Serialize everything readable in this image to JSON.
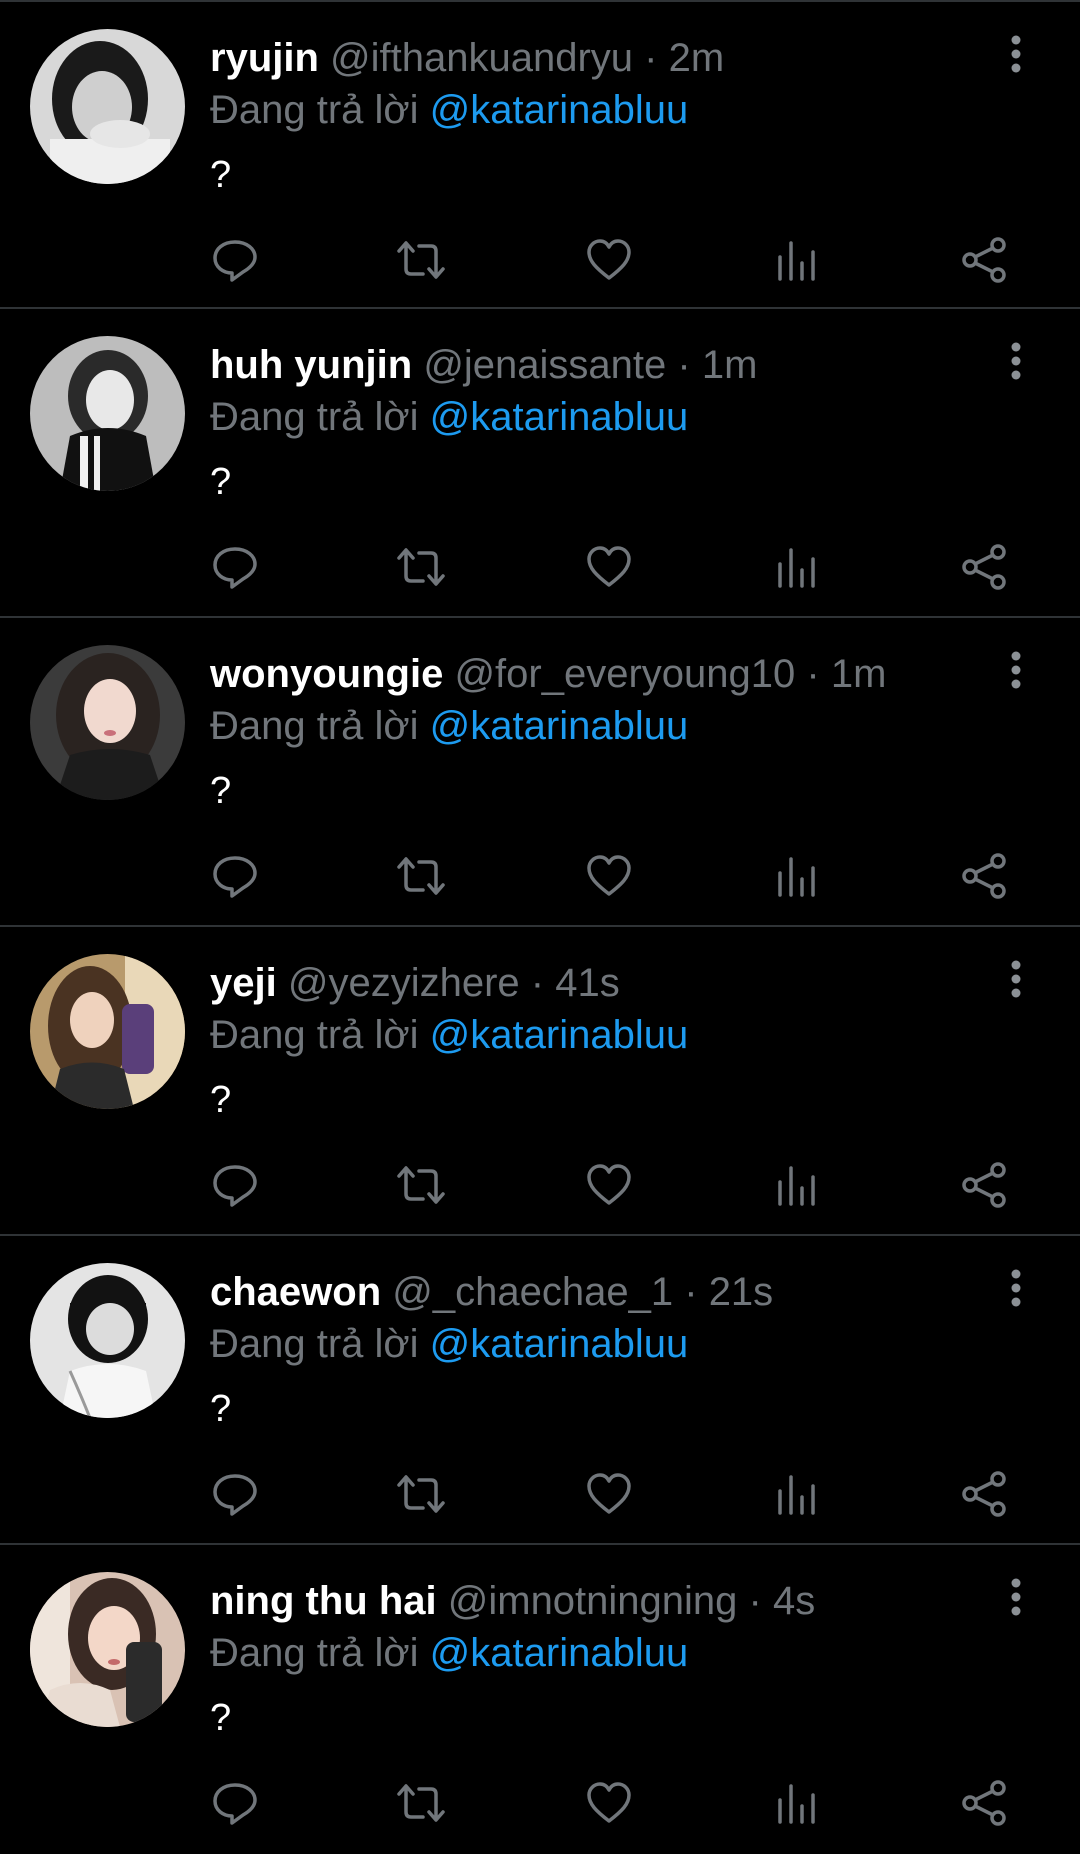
{
  "theme": {
    "background": "#000000",
    "divider": "#2f3336",
    "name_color": "#ffffff",
    "muted_color": "#71767b",
    "link_color": "#1d9bf0",
    "icon_color": "#71767b"
  },
  "icons": {
    "reply": "reply-icon",
    "retweet": "retweet-icon",
    "like": "heart-icon",
    "views": "views-bar-chart-icon",
    "share": "share-icon",
    "more": "vertical-dots-icon"
  },
  "tweets": [
    {
      "display_name": "ryujin",
      "handle": "@ifthankuandryu",
      "separator": "·",
      "time": "2m",
      "reply_prefix": "Đang trả lời",
      "reply_to": "@katarinabluu",
      "text": "?"
    },
    {
      "display_name": "huh yunjin",
      "handle": "@jenaissante",
      "separator": "·",
      "time": "1m",
      "reply_prefix": "Đang trả lời",
      "reply_to": "@katarinabluu",
      "text": "?"
    },
    {
      "display_name": "wonyoungie",
      "handle": "@for_everyoung10",
      "separator": "·",
      "time": "1m",
      "reply_prefix": "Đang trả lời",
      "reply_to": "@katarinabluu",
      "text": "?"
    },
    {
      "display_name": "yeji",
      "handle": "@yezyizhere",
      "separator": "·",
      "time": "41s",
      "reply_prefix": "Đang trả lời",
      "reply_to": "@katarinabluu",
      "text": "?"
    },
    {
      "display_name": "chaewon",
      "handle": "@_chaechae_1",
      "separator": "·",
      "time": "21s",
      "reply_prefix": "Đang trả lời",
      "reply_to": "@katarinabluu",
      "text": "?"
    },
    {
      "display_name": "ning thu hai",
      "handle": "@imnotningning",
      "separator": "·",
      "time": "4s",
      "reply_prefix": "Đang trả lời",
      "reply_to": "@katarinabluu",
      "text": "?"
    }
  ]
}
